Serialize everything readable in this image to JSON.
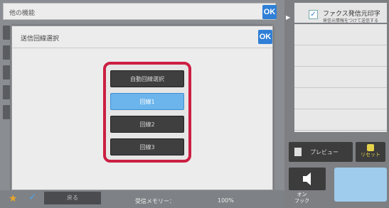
{
  "header": {
    "title": "他の機能",
    "ok_label": "OK"
  },
  "dialog": {
    "title": "送信回線選択",
    "ok_label": "OK",
    "options": [
      {
        "label": "自動回線選択",
        "selected": false
      },
      {
        "label": "回線1",
        "selected": true
      },
      {
        "label": "回線2",
        "selected": false
      },
      {
        "label": "回線3",
        "selected": false
      }
    ]
  },
  "right_panel": {
    "fax_title": "ファクス発信元印字",
    "fax_sub": "発信元情報をつけて送信する",
    "preview_label": "プレビュー",
    "reset_label": "リセット",
    "onhook_label": "オン\nフック"
  },
  "footer": {
    "back_label": "戻る",
    "memory_label": "受信メモリー：",
    "memory_value": "100%"
  },
  "colors": {
    "accent": "#2f7fd6",
    "highlight": "#cc1f43",
    "selected": "#6bb4ec"
  }
}
